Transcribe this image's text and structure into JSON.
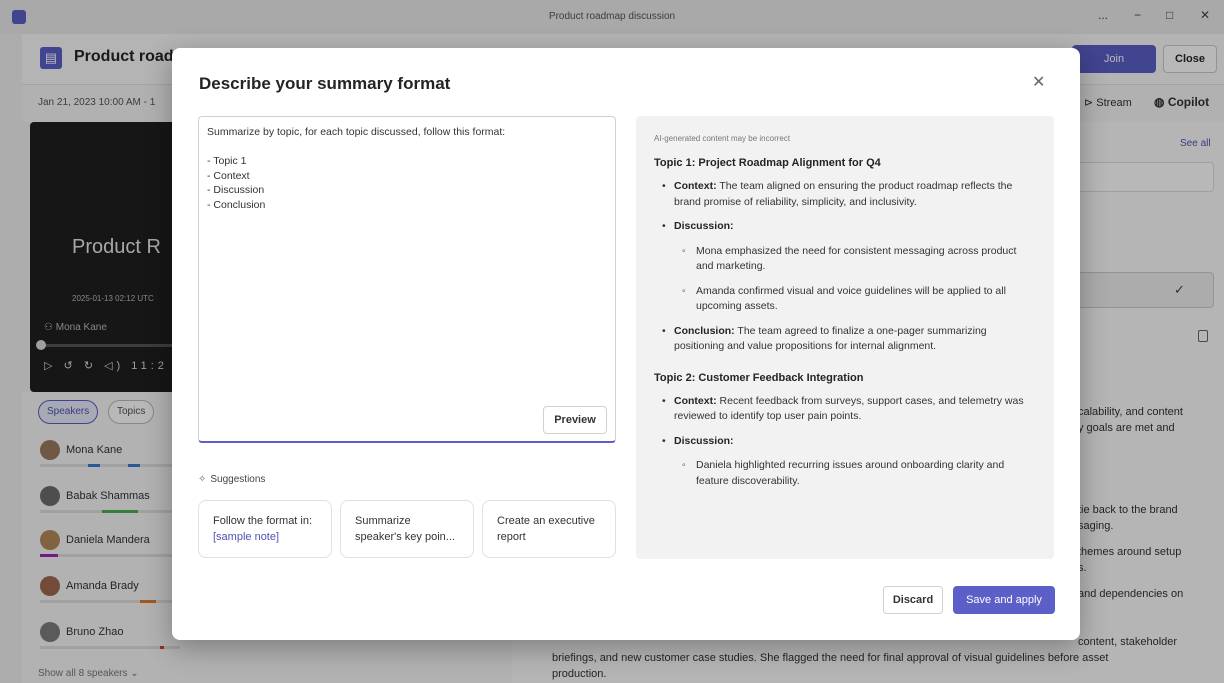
{
  "window": {
    "title": "Product roadmap discussion",
    "controls": [
      "...",
      "−",
      "□",
      "✕"
    ]
  },
  "app_header": {
    "meeting_title": "Product roadm",
    "join_label": "Join",
    "close_label": "Close"
  },
  "app_sub": {
    "date": "Jan 21, 2023 10:00 AM - 1",
    "stream_label": "Stream",
    "copilot_label": "Copilot"
  },
  "video": {
    "title": "Product R",
    "datetime": "2025-01-13 02:12 UTC",
    "recorded_by": "Mona Kane",
    "time": "11:2"
  },
  "tabs": {
    "speakers": "Speakers",
    "topics": "Topics"
  },
  "speakers": [
    {
      "name": "Mona Kane"
    },
    {
      "name": "Babak Shammas"
    },
    {
      "name": "Daniela Mandera"
    },
    {
      "name": "Amanda Brady"
    },
    {
      "name": "Bruno Zhao"
    }
  ],
  "show_all_speakers": "Show all 8 speakers",
  "right_panel": {
    "see_all": "See all",
    "text_1": "calability, and content",
    "text_2": "y goals are met and",
    "text_3": "tie back to the brand",
    "text_4": "saging.",
    "text_5": "themes around setup",
    "text_6": "s.",
    "text_7": "and dependencies on",
    "text_8": "content, stakeholder",
    "text_9": "briefings, and new customer case studies. She flagged the need for final approval of visual guidelines before asset",
    "text_10": "production."
  },
  "dialog": {
    "title": "Describe your summary format",
    "close_icon_glyph": "✕",
    "prompt_text": "Summarize by topic, for each topic discussed, follow this format:\n\n- Topic 1\n- Context\n- Discussion\n- Conclusion",
    "preview_label": "Preview",
    "suggestions_label": "Suggestions",
    "suggestions": [
      {
        "text": "Follow the format in: ",
        "link": "[sample note]"
      },
      {
        "text": "Summarize speaker's key poin..."
      },
      {
        "text": "Create an executive report"
      }
    ],
    "preview": {
      "ai_note": "AI-generated content may be incorrect",
      "topic1": {
        "title": "Topic 1: Project Roadmap Alignment for Q4",
        "context_label": "Context:",
        "context": "The team aligned on ensuring the product roadmap reflects the brand promise of reliability, simplicity, and inclusivity.",
        "discussion_label": "Discussion:",
        "discussion_points": [
          "Mona emphasized the need for consistent messaging across product and marketing.",
          "Amanda confirmed visual and voice guidelines will be applied to all upcoming assets."
        ],
        "conclusion_label": "Conclusion:",
        "conclusion": "The team agreed to finalize a one-pager summarizing positioning and value propositions for internal alignment."
      },
      "topic2": {
        "title": "Topic 2: Customer Feedback Integration",
        "context_label": "Context:",
        "context": "Recent feedback from surveys, support cases, and telemetry was reviewed to identify top user pain points.",
        "discussion_label": "Discussion:",
        "discussion_points": [
          "Daniela highlighted recurring issues around onboarding clarity and feature discoverability."
        ]
      }
    },
    "discard_label": "Discard",
    "save_label": "Save and apply"
  },
  "colors": {
    "accent": "#5b5fc7",
    "link": "#4f52b2",
    "preview_bg": "#f2f2f2"
  }
}
